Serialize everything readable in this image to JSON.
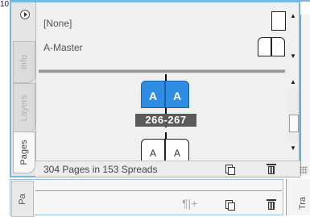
{
  "background": {
    "left_number_fragment": "10",
    "right_tab_label": "Tra",
    "lower_tab_label": "Pa",
    "lower_pilcrow": "¶|+"
  },
  "panel": {
    "side_tabs": [
      {
        "label": "Info",
        "active": false
      },
      {
        "label": "Layers",
        "active": false
      },
      {
        "label": "Pages",
        "active": true
      }
    ],
    "masters": [
      {
        "label": "[None]",
        "icon": "single-page-icon"
      },
      {
        "label": "A-Master",
        "icon": "spread-icon"
      }
    ],
    "pages": {
      "selected_spread": {
        "left_prefix": "A",
        "right_prefix": "A",
        "label": "266-267"
      },
      "next_spread": {
        "left_prefix": "A",
        "right_prefix": "A"
      }
    },
    "status": {
      "text": "304 Pages in 153 Spreads",
      "new_page_icon": "new-page-icon",
      "delete_icon": "trash-icon"
    }
  },
  "colors": {
    "selection": "#2f8de4",
    "panel_border": "#7ab7d8"
  }
}
